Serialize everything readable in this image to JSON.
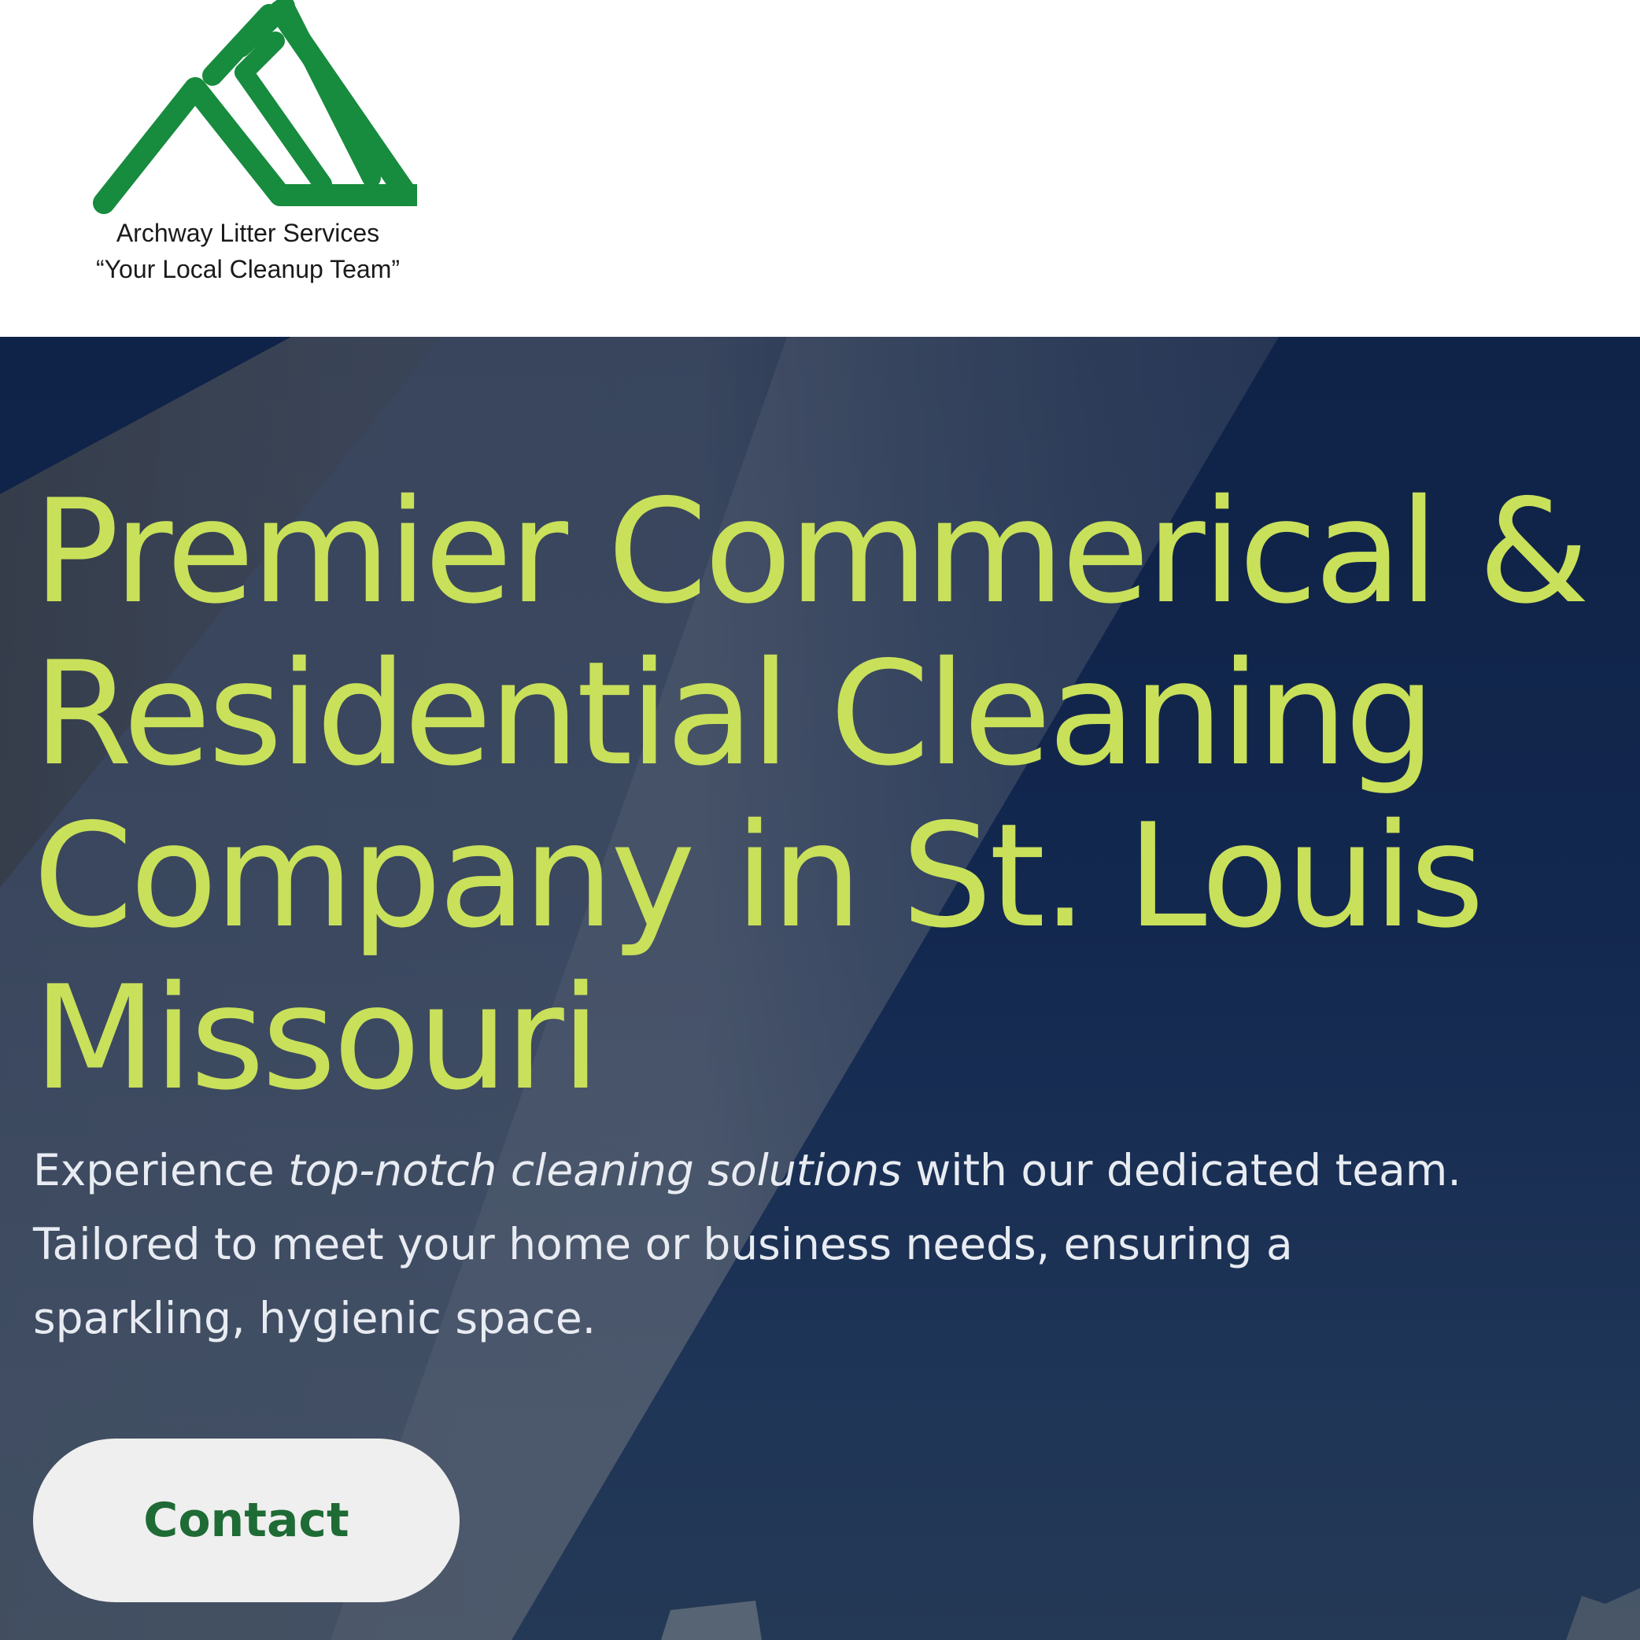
{
  "header": {
    "logo": {
      "company_name": "Archway Litter Services",
      "tagline": "“Your Local   Cleanup Team”"
    }
  },
  "hero": {
    "title": "Premier Commerical &\nResidential Cleaning\nCompany in St. Louis\nMissouri",
    "description": {
      "before": "Experience ",
      "emphasis": "top-notch cleaning solutions",
      "after": " with our dedicated team. Tailored to meet your home or business needs, ensuring a sparkling, hygienic space."
    },
    "cta_label": "Contact"
  },
  "colors": {
    "brand_green": "#178b3e",
    "headline_lime": "#c9e05a",
    "hero_navy": "#13284f",
    "button_text_green": "#1f6b35",
    "button_bg": "#efefef"
  }
}
